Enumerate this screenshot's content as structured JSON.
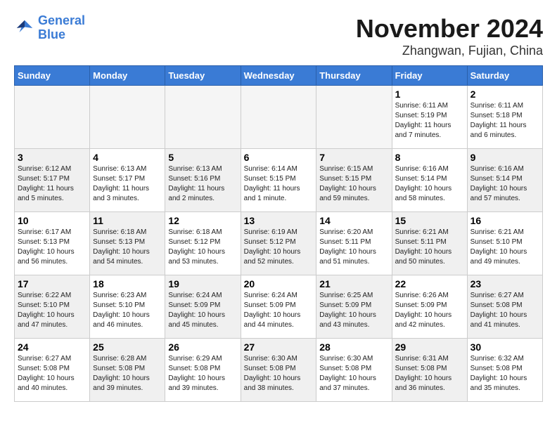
{
  "logo": {
    "line1": "General",
    "line2": "Blue"
  },
  "title": {
    "month": "November 2024",
    "location": "Zhangwan, Fujian, China"
  },
  "weekdays": [
    "Sunday",
    "Monday",
    "Tuesday",
    "Wednesday",
    "Thursday",
    "Friday",
    "Saturday"
  ],
  "weeks": [
    [
      {
        "day": "",
        "info": "",
        "empty": true
      },
      {
        "day": "",
        "info": "",
        "empty": true
      },
      {
        "day": "",
        "info": "",
        "empty": true
      },
      {
        "day": "",
        "info": "",
        "empty": true
      },
      {
        "day": "",
        "info": "",
        "empty": true
      },
      {
        "day": "1",
        "info": "Sunrise: 6:11 AM\nSunset: 5:19 PM\nDaylight: 11 hours\nand 7 minutes."
      },
      {
        "day": "2",
        "info": "Sunrise: 6:11 AM\nSunset: 5:18 PM\nDaylight: 11 hours\nand 6 minutes."
      }
    ],
    [
      {
        "day": "3",
        "info": "Sunrise: 6:12 AM\nSunset: 5:17 PM\nDaylight: 11 hours\nand 5 minutes.",
        "shaded": true
      },
      {
        "day": "4",
        "info": "Sunrise: 6:13 AM\nSunset: 5:17 PM\nDaylight: 11 hours\nand 3 minutes."
      },
      {
        "day": "5",
        "info": "Sunrise: 6:13 AM\nSunset: 5:16 PM\nDaylight: 11 hours\nand 2 minutes.",
        "shaded": true
      },
      {
        "day": "6",
        "info": "Sunrise: 6:14 AM\nSunset: 5:15 PM\nDaylight: 11 hours\nand 1 minute."
      },
      {
        "day": "7",
        "info": "Sunrise: 6:15 AM\nSunset: 5:15 PM\nDaylight: 10 hours\nand 59 minutes.",
        "shaded": true
      },
      {
        "day": "8",
        "info": "Sunrise: 6:16 AM\nSunset: 5:14 PM\nDaylight: 10 hours\nand 58 minutes."
      },
      {
        "day": "9",
        "info": "Sunrise: 6:16 AM\nSunset: 5:14 PM\nDaylight: 10 hours\nand 57 minutes.",
        "shaded": true
      }
    ],
    [
      {
        "day": "10",
        "info": "Sunrise: 6:17 AM\nSunset: 5:13 PM\nDaylight: 10 hours\nand 56 minutes."
      },
      {
        "day": "11",
        "info": "Sunrise: 6:18 AM\nSunset: 5:13 PM\nDaylight: 10 hours\nand 54 minutes.",
        "shaded": true
      },
      {
        "day": "12",
        "info": "Sunrise: 6:18 AM\nSunset: 5:12 PM\nDaylight: 10 hours\nand 53 minutes."
      },
      {
        "day": "13",
        "info": "Sunrise: 6:19 AM\nSunset: 5:12 PM\nDaylight: 10 hours\nand 52 minutes.",
        "shaded": true
      },
      {
        "day": "14",
        "info": "Sunrise: 6:20 AM\nSunset: 5:11 PM\nDaylight: 10 hours\nand 51 minutes."
      },
      {
        "day": "15",
        "info": "Sunrise: 6:21 AM\nSunset: 5:11 PM\nDaylight: 10 hours\nand 50 minutes.",
        "shaded": true
      },
      {
        "day": "16",
        "info": "Sunrise: 6:21 AM\nSunset: 5:10 PM\nDaylight: 10 hours\nand 49 minutes."
      }
    ],
    [
      {
        "day": "17",
        "info": "Sunrise: 6:22 AM\nSunset: 5:10 PM\nDaylight: 10 hours\nand 47 minutes.",
        "shaded": true
      },
      {
        "day": "18",
        "info": "Sunrise: 6:23 AM\nSunset: 5:10 PM\nDaylight: 10 hours\nand 46 minutes."
      },
      {
        "day": "19",
        "info": "Sunrise: 6:24 AM\nSunset: 5:09 PM\nDaylight: 10 hours\nand 45 minutes.",
        "shaded": true
      },
      {
        "day": "20",
        "info": "Sunrise: 6:24 AM\nSunset: 5:09 PM\nDaylight: 10 hours\nand 44 minutes."
      },
      {
        "day": "21",
        "info": "Sunrise: 6:25 AM\nSunset: 5:09 PM\nDaylight: 10 hours\nand 43 minutes.",
        "shaded": true
      },
      {
        "day": "22",
        "info": "Sunrise: 6:26 AM\nSunset: 5:09 PM\nDaylight: 10 hours\nand 42 minutes."
      },
      {
        "day": "23",
        "info": "Sunrise: 6:27 AM\nSunset: 5:08 PM\nDaylight: 10 hours\nand 41 minutes.",
        "shaded": true
      }
    ],
    [
      {
        "day": "24",
        "info": "Sunrise: 6:27 AM\nSunset: 5:08 PM\nDaylight: 10 hours\nand 40 minutes."
      },
      {
        "day": "25",
        "info": "Sunrise: 6:28 AM\nSunset: 5:08 PM\nDaylight: 10 hours\nand 39 minutes.",
        "shaded": true
      },
      {
        "day": "26",
        "info": "Sunrise: 6:29 AM\nSunset: 5:08 PM\nDaylight: 10 hours\nand 39 minutes."
      },
      {
        "day": "27",
        "info": "Sunrise: 6:30 AM\nSunset: 5:08 PM\nDaylight: 10 hours\nand 38 minutes.",
        "shaded": true
      },
      {
        "day": "28",
        "info": "Sunrise: 6:30 AM\nSunset: 5:08 PM\nDaylight: 10 hours\nand 37 minutes."
      },
      {
        "day": "29",
        "info": "Sunrise: 6:31 AM\nSunset: 5:08 PM\nDaylight: 10 hours\nand 36 minutes.",
        "shaded": true
      },
      {
        "day": "30",
        "info": "Sunrise: 6:32 AM\nSunset: 5:08 PM\nDaylight: 10 hours\nand 35 minutes."
      }
    ]
  ]
}
